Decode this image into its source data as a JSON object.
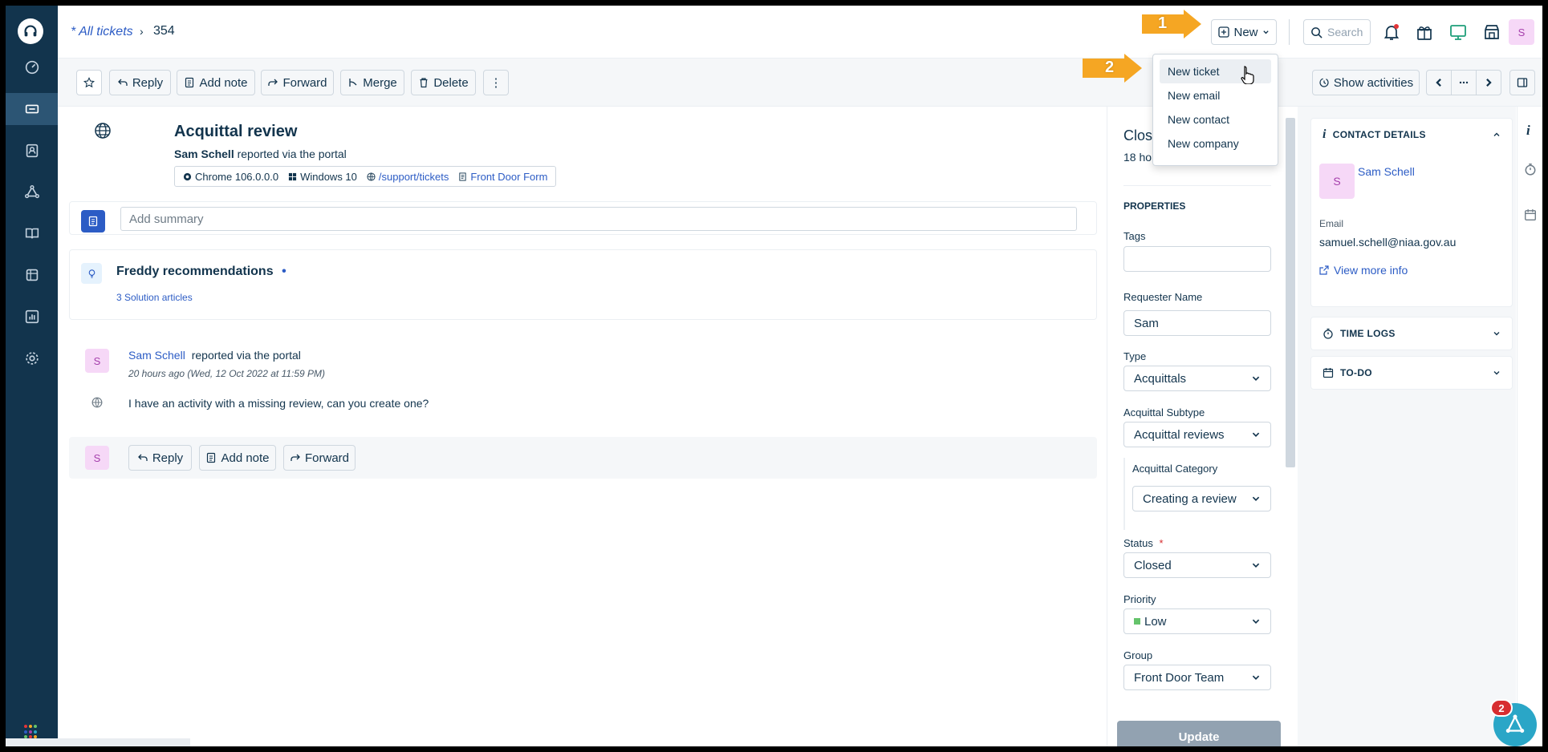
{
  "header": {
    "breadcrumb_link": "* All tickets",
    "breadcrumb_sep": "›",
    "ticket_id": "354",
    "new_label": "New",
    "search_placeholder": "Search",
    "avatar_initial": "S"
  },
  "new_menu": {
    "items": [
      "New ticket",
      "New email",
      "New contact",
      "New company"
    ]
  },
  "callouts": {
    "one": "1",
    "two": "2"
  },
  "toolbar": {
    "reply": "Reply",
    "add_note": "Add note",
    "forward": "Forward",
    "merge": "Merge",
    "delete": "Delete",
    "more": "⋮",
    "show_activities": "Show activities"
  },
  "ticket": {
    "title": "Acquittal review",
    "requester": "Sam Schell",
    "reported_via": "reported via the portal",
    "browser": "Chrome 106.0.0.0",
    "os": "Windows 10",
    "path": "/support/tickets",
    "form": "Front Door Form",
    "summary_placeholder": "Add summary"
  },
  "freddy": {
    "title": "Freddy recommendations",
    "dot": "•",
    "solutions": "3 Solution articles"
  },
  "conversation": {
    "avatar_initial": "S",
    "author": "Sam Schell",
    "via": "reported via the portal",
    "time": "20 hours ago (Wed, 12 Oct 2022 at 11:59 PM)",
    "body": "I have an activity with a missing review, can you create one?"
  },
  "reply_bar": {
    "avatar_initial": "S",
    "reply": "Reply",
    "add_note": "Add note",
    "forward": "Forward"
  },
  "properties": {
    "status_title": "Clos",
    "status_sub": "18 ho",
    "heading": "PROPERTIES",
    "tags_label": "Tags",
    "tags_value": "",
    "requester_label": "Requester Name",
    "requester_value": "Sam",
    "type_label": "Type",
    "type_value": "Acquittals",
    "subtype_label": "Acquittal Subtype",
    "subtype_value": "Acquittal reviews",
    "category_label": "Acquittal Category",
    "category_value": "Creating a review",
    "status_label": "Status",
    "required_mark": "*",
    "status_value": "Closed",
    "priority_label": "Priority",
    "priority_value": "Low",
    "group_label": "Group",
    "group_value": "Front Door Team",
    "update": "Update"
  },
  "contact": {
    "heading": "CONTACT DETAILS",
    "avatar_initial": "S",
    "name": "Sam Schell",
    "email_label": "Email",
    "email": "samuel.schell@niaa.gov.au",
    "more": "View more info"
  },
  "time_logs": {
    "heading": "TIME LOGS"
  },
  "todo": {
    "heading": "TO-DO"
  },
  "assistant": {
    "badge": "2"
  },
  "colors": {
    "sidebar": "#12344d",
    "accent": "#2c5cc5",
    "callout": "#f5a623",
    "priority_low": "#65c36b",
    "notification_dot": "#e43538"
  }
}
